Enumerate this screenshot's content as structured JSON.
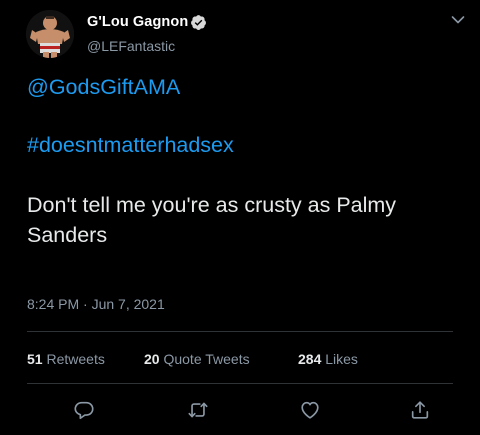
{
  "author": {
    "display_name": "G'Lou Gagnon",
    "handle": "@LEFantastic",
    "verified": true
  },
  "tweet": {
    "mention": "@GodsGiftAMA",
    "hashtag": "#doesntmatterhadsex",
    "body": "Don't tell me you're as crusty as Palmy Sanders",
    "timestamp": "8:24 PM · Jun 7, 2021"
  },
  "stats": {
    "retweets": {
      "count": "51",
      "label": "Retweets"
    },
    "quote_tweets": {
      "count": "20",
      "label": "Quote Tweets"
    },
    "likes": {
      "count": "284",
      "label": "Likes"
    }
  },
  "actions": [
    "reply-icon",
    "retweet-icon",
    "like-icon",
    "share-icon"
  ],
  "colors": {
    "background": "#000000",
    "link": "#1d9bf0",
    "secondary_text": "#8b98a5",
    "primary_text": "#e7e9ea",
    "divider": "#2f3336"
  }
}
